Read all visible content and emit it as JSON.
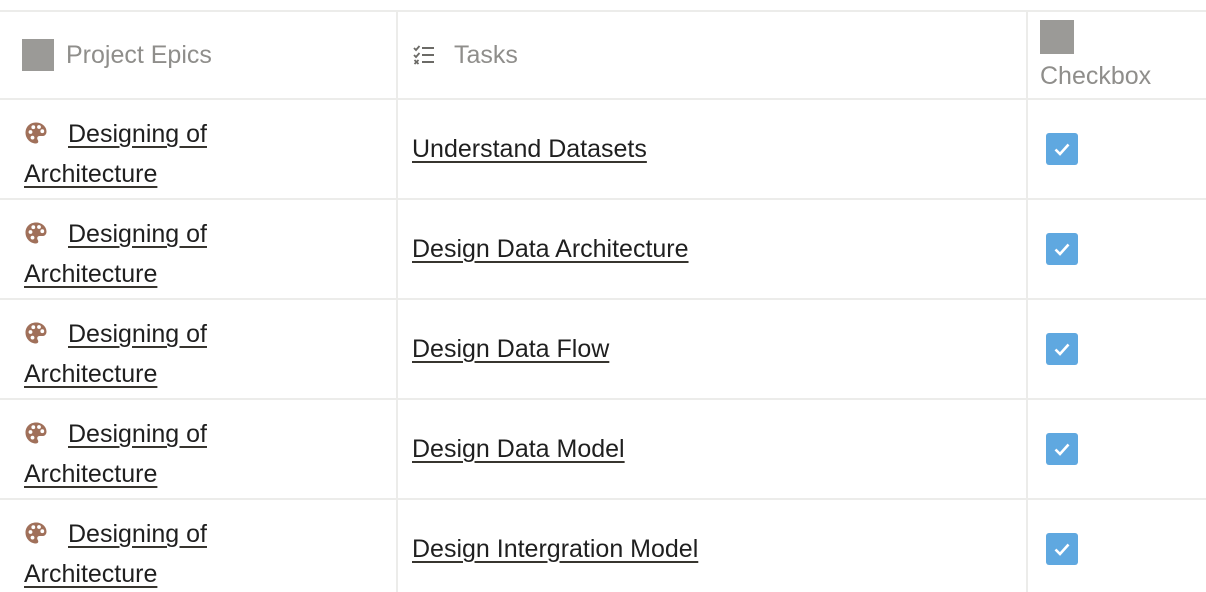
{
  "columns": {
    "epics": "Project Epics",
    "tasks": "Tasks",
    "checkbox": "Checkbox"
  },
  "colors": {
    "checkbox_fill": "#5fa8e0",
    "palette_icon": "#a0705a",
    "header_text": "#8f8e8b",
    "grid_line": "#ececea"
  },
  "icons": {
    "epic_header": "gray-square-icon",
    "task_header": "checklist-icon",
    "row_epic": "palette-icon",
    "checkbox_checked": "checkmark-icon"
  },
  "rows": [
    {
      "epic_line1": "Designing of",
      "epic_line2": "Architecture",
      "task": "Understand Datasets",
      "checked": true
    },
    {
      "epic_line1": "Designing of",
      "epic_line2": "Architecture",
      "task": "Design Data Architecture",
      "checked": true
    },
    {
      "epic_line1": "Designing of",
      "epic_line2": "Architecture",
      "task": "Design Data Flow",
      "checked": true
    },
    {
      "epic_line1": "Designing of",
      "epic_line2": "Architecture",
      "task": "Design Data Model",
      "checked": true
    },
    {
      "epic_line1": "Designing of",
      "epic_line2": "Architecture",
      "task": "Design Intergration Model",
      "checked": true
    }
  ]
}
